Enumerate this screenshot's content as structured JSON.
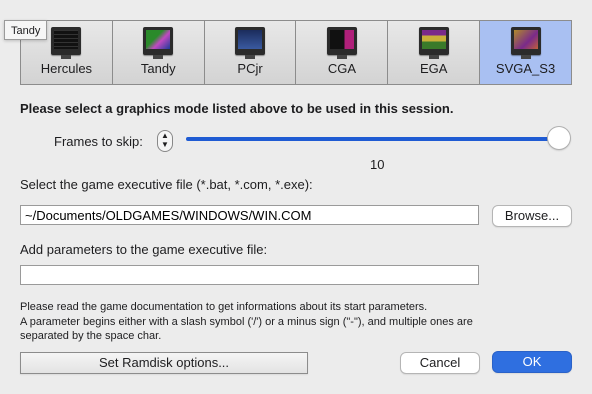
{
  "tooltip": "Tandy",
  "modes": [
    {
      "label": "Hercules",
      "icon": "hercules-monitor-icon",
      "selected": false
    },
    {
      "label": "Tandy",
      "icon": "tandy-monitor-icon",
      "selected": false
    },
    {
      "label": "PCjr",
      "icon": "pcjr-monitor-icon",
      "selected": false
    },
    {
      "label": "CGA",
      "icon": "cga-monitor-icon",
      "selected": false
    },
    {
      "label": "EGA",
      "icon": "ega-monitor-icon",
      "selected": false
    },
    {
      "label": "SVGA_S3",
      "icon": "svga-monitor-icon",
      "selected": true
    }
  ],
  "heading": "Please select a graphics mode listed above to be used in this session.",
  "frameskip": {
    "label": "Frames to skip:",
    "value": "10",
    "level": 1.0
  },
  "executable": {
    "label": "Select the game executive file (*.bat, *.com, *.exe):",
    "value": "~/Documents/OLDGAMES/WINDOWS/WIN.COM",
    "browse_label": "Browse..."
  },
  "parameters": {
    "label": "Add parameters to the game executive file:",
    "value": ""
  },
  "info_lines": [
    "Please read the game documentation to get informations about its start parameters.",
    "A parameter begins either with a slash symbol ('/') or a minus sign (\"-\"), and multiple ones are",
    "separated by the space char."
  ],
  "buttons": {
    "ramdisk": "Set Ramdisk options...",
    "cancel": "Cancel",
    "ok": "OK"
  },
  "colors": {
    "accent": "#2f6fe0",
    "selected_tile": "#a9c0f2"
  }
}
